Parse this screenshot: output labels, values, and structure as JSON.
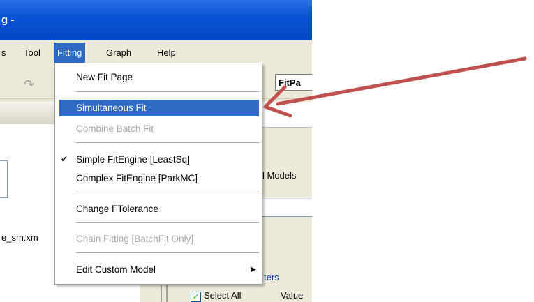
{
  "window": {
    "title_fragment": "g -"
  },
  "menubar": {
    "items": [
      {
        "label": "s"
      },
      {
        "label": "Tool"
      },
      {
        "label": "Fitting"
      },
      {
        "label": "Graph"
      },
      {
        "label": "Help"
      }
    ]
  },
  "toolbar": {
    "fitpage_label": "FitPa"
  },
  "left_panel": {
    "file_label": "e_sm.xm"
  },
  "right_panel": {
    "models_label": "l Models",
    "params_label": "ters",
    "select_all_label": "Select All",
    "value_header": "Value"
  },
  "fitting_menu": {
    "new_fit_page": "New Fit Page",
    "simultaneous_fit": "Simultaneous Fit",
    "combine_batch_fit": "Combine Batch Fit",
    "simple_fitengine": "Simple FitEngine [LeastSq]",
    "complex_fitengine": "Complex FitEngine [ParkMC]",
    "change_ftolerance": "Change FTolerance",
    "chain_fitting": "Chain Fitting [BatchFit Only]",
    "edit_custom_model": "Edit Custom Model"
  },
  "colors": {
    "title_bar": "#0a53d6",
    "menu_highlight": "#316ac5",
    "annotation_arrow": "#c0504d"
  }
}
